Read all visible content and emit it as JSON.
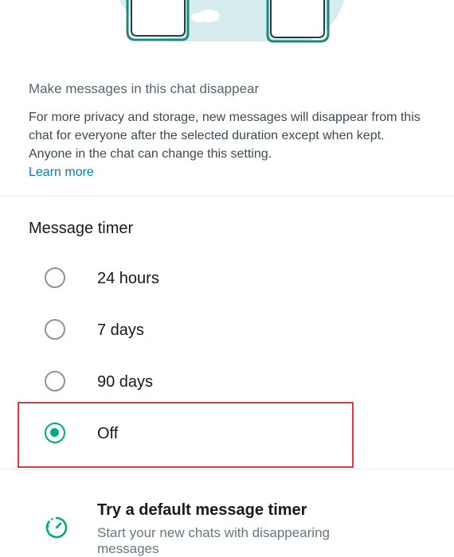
{
  "intro": {
    "heading": "Make messages in this chat disappear",
    "body": "For more privacy and storage, new messages will disappear from this chat for everyone after the selected duration except when kept. Anyone in the chat can change this setting.",
    "learn_more": "Learn more"
  },
  "timer": {
    "title": "Message timer",
    "selected": "Off",
    "options": [
      {
        "label": "24 hours",
        "checked": false
      },
      {
        "label": "7 days",
        "checked": false
      },
      {
        "label": "90 days",
        "checked": false
      },
      {
        "label": "Off",
        "checked": true
      }
    ]
  },
  "default_timer": {
    "title": "Try a default message timer",
    "subtitle": "Start your new chats with disappearing messages",
    "icon": "timer-icon"
  },
  "colors": {
    "accent": "#00a884",
    "link": "#027eb5",
    "highlight": "#e0393e",
    "radio_off": "#8696a0"
  }
}
